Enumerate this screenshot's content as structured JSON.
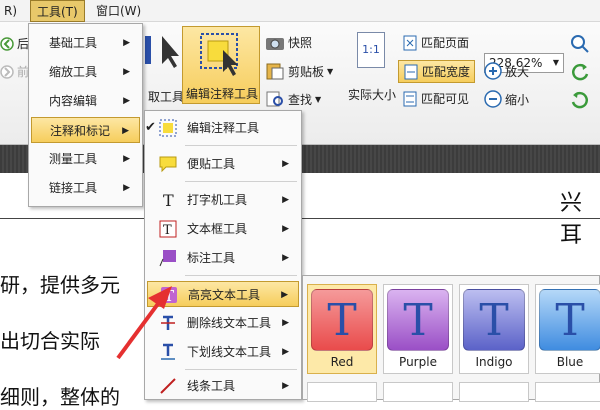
{
  "menubar": {
    "item0": "R)",
    "tools": "工具(T)",
    "window": "窗口(W)"
  },
  "ribbon": {
    "nav0": "后",
    "nav1": "前",
    "select_label": "取工具",
    "edit_anno": "编辑注释工具",
    "snapshot": "快照",
    "clipboard": "剪贴板",
    "find": "查找",
    "actual_size": "实际大小",
    "actual_icon": "1:1",
    "fit_page": "匹配页面",
    "fit_width": "匹配宽度",
    "fit_visible": "匹配可见",
    "zoom_value": "228.62%",
    "zoom_in": "放大",
    "zoom_out": "缩小"
  },
  "menu1": {
    "items": [
      "基础工具",
      "缩放工具",
      "内容编辑",
      "注释和标记",
      "测量工具",
      "链接工具"
    ]
  },
  "menu2": {
    "items": [
      "编辑注释工具",
      "便贴工具",
      "打字机工具",
      "文本框工具",
      "标注工具",
      "高亮文本工具",
      "删除线文本工具",
      "下划线文本工具",
      "线条工具"
    ],
    "checkmark": "✔"
  },
  "icons": {
    "typewriter_letter": "T",
    "textbox_letter": "T",
    "highlight_letter": "T"
  },
  "highlight_colors": [
    {
      "name": "Red",
      "color": "#e94b4b"
    },
    {
      "name": "Purple",
      "color": "#9a4fc6"
    },
    {
      "name": "Indigo",
      "color": "#5b62c8"
    },
    {
      "name": "Blue",
      "color": "#3f8ce0"
    }
  ],
  "document": {
    "line0": "兴 耳",
    "line1": "研，提供多元",
    "line2": "出切合实际",
    "line3": "细则，整体的"
  },
  "colors": {
    "accent": "#f6cd5c",
    "arrow": "#e53030"
  }
}
